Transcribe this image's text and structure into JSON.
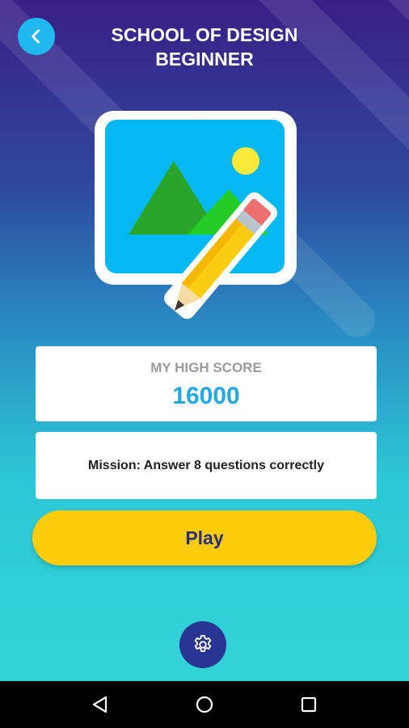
{
  "header": {
    "title_line1": "SCHOOL OF DESIGN",
    "title_line2": "BEGINNER",
    "back_icon": "chevron-left-icon"
  },
  "hero": {
    "icon": "image-edit-icon"
  },
  "score": {
    "label": "MY HIGH SCORE",
    "value": "16000"
  },
  "mission": {
    "text": "Mission: Answer 8 questions correctly"
  },
  "play": {
    "label": "Play"
  },
  "settings": {
    "icon": "gear-icon"
  },
  "colors": {
    "accent_blue": "#23a8e4",
    "play_yellow": "#fccc0a",
    "settings_navy": "#283593"
  },
  "navbar": {
    "items": [
      "back-triangle-icon",
      "home-circle-icon",
      "recents-square-icon"
    ]
  }
}
